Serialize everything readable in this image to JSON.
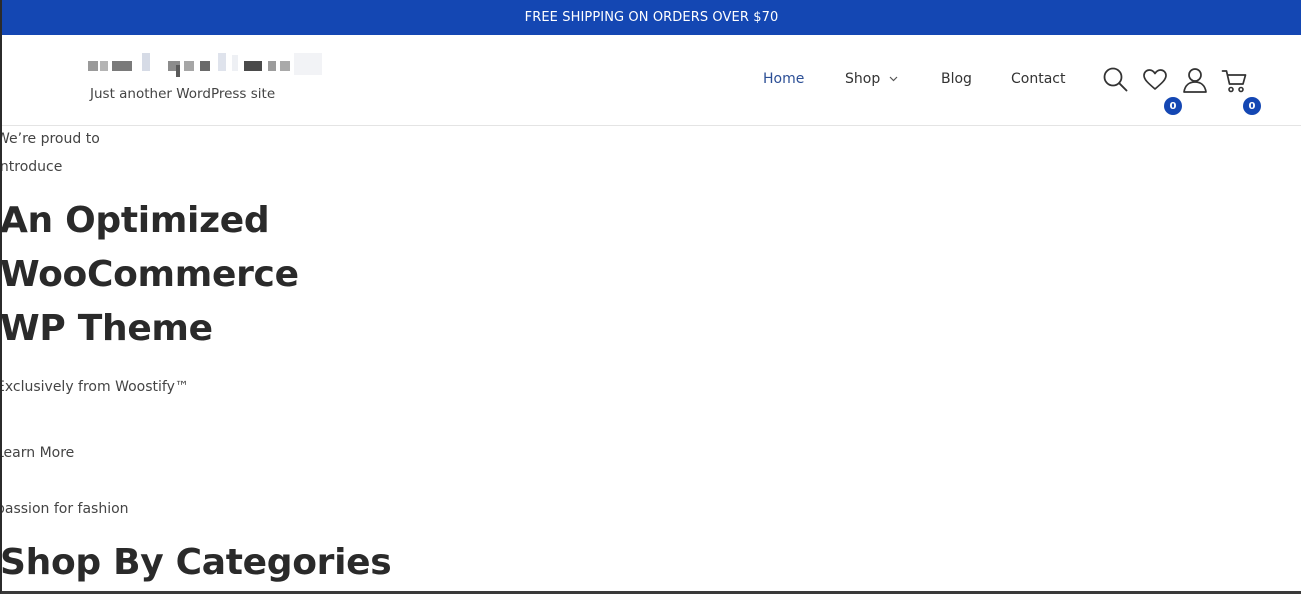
{
  "announcement": "FREE SHIPPING ON ORDERS OVER $70",
  "site": {
    "tagline": "Just another WordPress site"
  },
  "nav": {
    "home": "Home",
    "shop": "Shop",
    "blog": "Blog",
    "contact": "Contact"
  },
  "header_icons": {
    "search": "search-icon",
    "wishlist": "heart-icon",
    "wishlist_count": "0",
    "account": "user-icon",
    "cart": "cart-icon",
    "cart_count": "0"
  },
  "hero": {
    "intro_line1": "We’re proud to",
    "intro_line2": "introduce",
    "heading_line1": "An Optimized",
    "heading_line2": "WooCommerce",
    "heading_line3": "WP Theme",
    "subtitle": "Exclusively from Woostify™",
    "cta": "Learn More"
  },
  "categories_section": {
    "eyebrow": "passion for fashion",
    "heading": "Shop By Categories"
  },
  "colors": {
    "brand_blue": "#1447b3",
    "nav_active": "#2c4f96",
    "text_dark": "#2a2a2a"
  }
}
